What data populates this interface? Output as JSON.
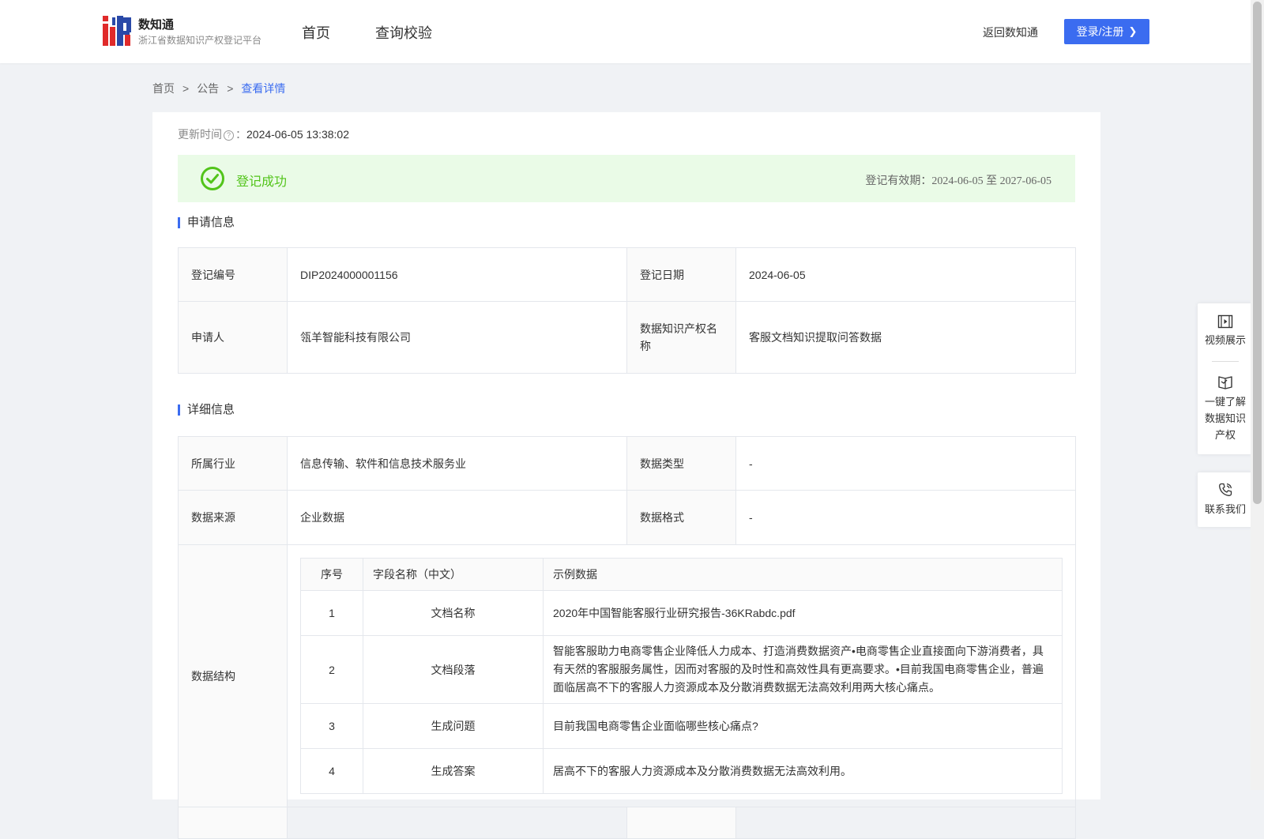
{
  "header": {
    "brand_name": "数知通",
    "brand_sub": "浙江省数据知识产权登记平台",
    "nav": {
      "home": "首页",
      "query": "查询校验"
    },
    "back_link": "返回数知通",
    "login_label": "登录/注册",
    "accent": "#3b6cf0"
  },
  "breadcrumb": {
    "home": "首页",
    "sep": ">",
    "notice": "公告",
    "current": "查看详情"
  },
  "detail": {
    "update_label": "更新时间",
    "update_colon": "：",
    "update_value": "2024-06-05 13:38:02",
    "status": {
      "text": "登记成功",
      "validity_label": "登记有效期：",
      "validity_value": "2024-06-05 至 2027-06-05",
      "color": "#52c41a"
    },
    "application_section": "申请信息",
    "application": {
      "reg_no_label": "登记编号",
      "reg_no": "DIP2024000001156",
      "reg_date_label": "登记日期",
      "reg_date": "2024-06-05",
      "applicant_label": "申请人",
      "applicant": "瓴羊智能科技有限公司",
      "ip_name_label": "数据知识产权名称",
      "ip_name": "客服文档知识提取问答数据"
    },
    "detail_section": "详细信息",
    "details": {
      "industry_label": "所属行业",
      "industry": "信息传输、软件和信息技术服务业",
      "data_type_label": "数据类型",
      "data_type": "-",
      "source_label": "数据来源",
      "source": "企业数据",
      "format_label": "数据格式",
      "format": "-",
      "structure_label": "数据结构"
    },
    "structure": {
      "headers": [
        "序号",
        "字段名称（中文）",
        "示例数据"
      ],
      "rows": [
        [
          "1",
          "文档名称",
          "2020年中国智能客服行业研究报告-36KRabdc.pdf"
        ],
        [
          "2",
          "文档段落",
          "智能客服助力电商零售企业降低人力成本、打造消费数据资产•电商零售企业直接面向下游消费者，具有天然的客服服务属性，因而对客服的及时性和高效性具有更高要求。•目前我国电商零售企业，普遍面临居高不下的客服人力资源成本及分散消费数据无法高效利用两大核心痛点。"
        ],
        [
          "3",
          "生成问题",
          "目前我国电商零售企业面临哪些核心痛点?"
        ],
        [
          "4",
          "生成答案",
          "居高不下的客服人力资源成本及分散消费数据无法高效利用。"
        ]
      ]
    }
  },
  "float": {
    "video": "视频展示",
    "learn": "一键了解数据知识产权",
    "contact": "联系我们"
  }
}
